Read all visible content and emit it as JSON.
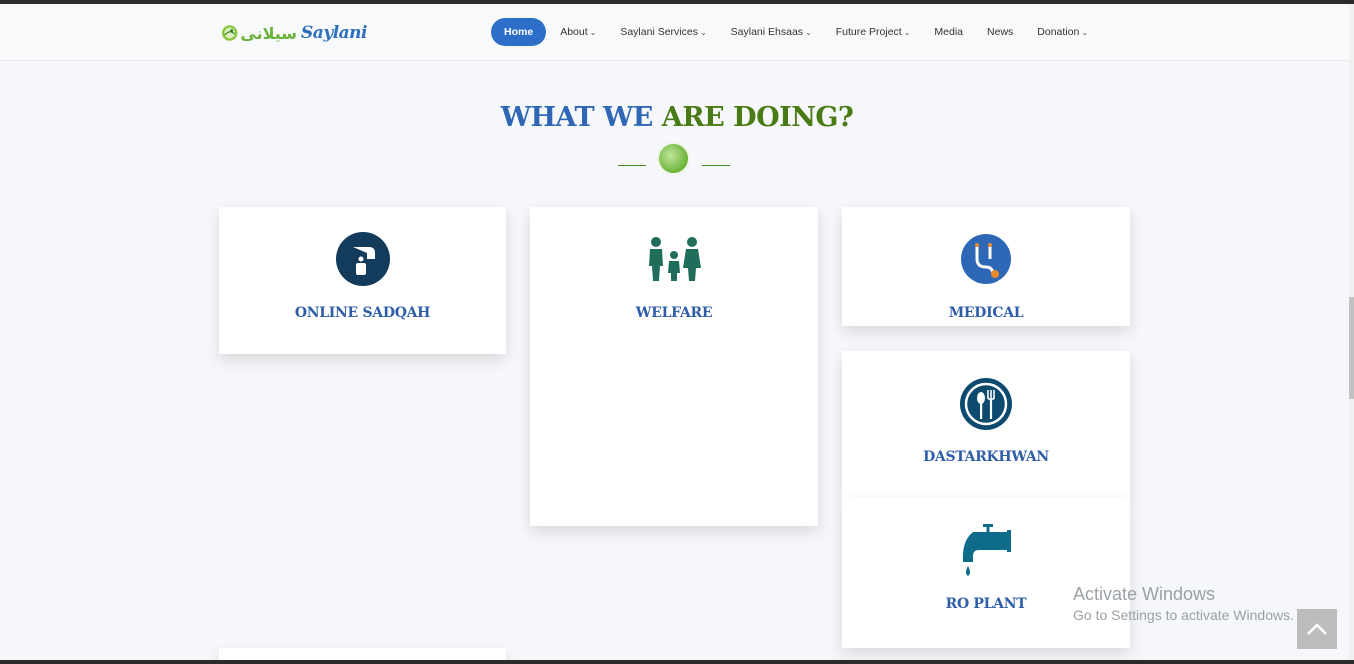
{
  "header": {
    "logo_text": "Saylani",
    "logo_urdu": "سیلانی",
    "nav": [
      {
        "label": "Home",
        "active": true,
        "dropdown": false
      },
      {
        "label": "About",
        "active": false,
        "dropdown": true
      },
      {
        "label": "Saylani Services",
        "active": false,
        "dropdown": true
      },
      {
        "label": "Saylani Ehsaas",
        "active": false,
        "dropdown": true
      },
      {
        "label": "Future Project",
        "active": false,
        "dropdown": true
      },
      {
        "label": "Media",
        "active": false,
        "dropdown": false
      },
      {
        "label": "News",
        "active": false,
        "dropdown": false
      },
      {
        "label": "Donation",
        "active": false,
        "dropdown": true
      }
    ]
  },
  "section": {
    "title_part1": "WHAT WE",
    "title_part2": "ARE DOING?"
  },
  "cards": [
    {
      "label": "ONLINE SADQAH",
      "icon": "donation-hand-icon"
    },
    {
      "label": "WELFARE",
      "icon": "family-icon"
    },
    {
      "label": "MEDICAL",
      "icon": "stethoscope-icon"
    },
    {
      "label": "DASTARKHWAN",
      "icon": "spoon-fork-icon"
    },
    {
      "label": "RO PLANT",
      "icon": "water-tap-icon"
    }
  ],
  "watermark": {
    "line1": "Activate Windows",
    "line2": "Go to Settings to activate Windows."
  },
  "colors": {
    "nav_active": "#2d6fc8",
    "title_blue": "#2f67b6",
    "title_green": "#4a7a14",
    "card_label": "#2f5ea8"
  }
}
